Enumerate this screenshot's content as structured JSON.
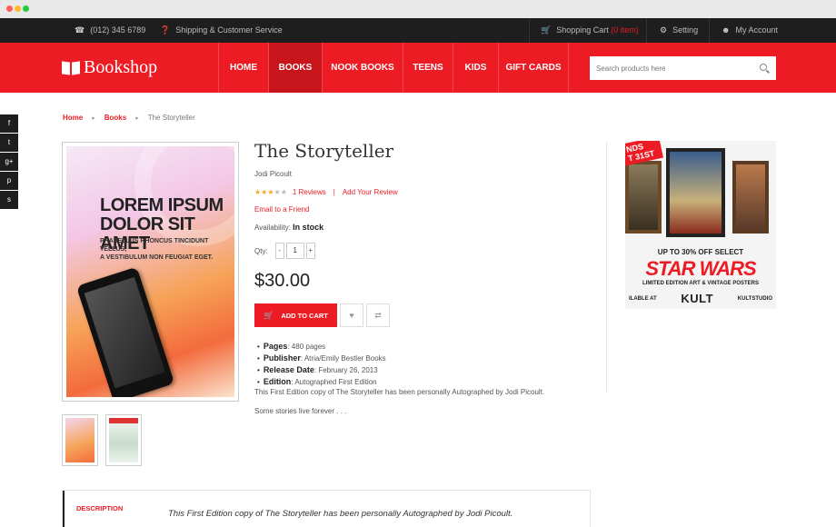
{
  "topbar": {
    "phone": "(012) 345 6789",
    "service": "Shipping & Customer Service",
    "cart_label": "Shopping Cart",
    "cart_count": "(0 item)",
    "setting": "Setting",
    "account": "My Account"
  },
  "brand": {
    "name": "Bookshop"
  },
  "nav": {
    "items": [
      {
        "label": "HOME"
      },
      {
        "label": "BOOKS"
      },
      {
        "label": "NOOK BOOKS"
      },
      {
        "label": "TEENS"
      },
      {
        "label": "KIDS"
      },
      {
        "label": "GIFT CARDS"
      }
    ],
    "active": "BOOKS"
  },
  "search": {
    "placeholder": "Search products here"
  },
  "social": [
    "f",
    "t",
    "g+",
    "p",
    "s"
  ],
  "breadcrumb": {
    "home": "Home",
    "section": "Books",
    "current": "The Storyteller"
  },
  "product": {
    "title": "The Storyteller",
    "author": "Jodi Picoult",
    "rating": 3,
    "rating_max": 5,
    "reviews": "1 Reviews",
    "add_review": "Add Your Review",
    "email_friend": "Email to a Friend",
    "availability_label": "Availability:",
    "availability_value": "In stock",
    "qty_label": "Qty:",
    "qty_minus": "-",
    "qty_value": "1",
    "qty_plus": "+",
    "price": "$30.00",
    "add_to_cart": "ADD TO CART",
    "specs": [
      {
        "key": "Pages",
        "value": "480 pages"
      },
      {
        "key": "Publisher",
        "value": "Atria/Emily Bestler Books"
      },
      {
        "key": "Release Date",
        "value": "February 26, 2013"
      },
      {
        "key": "Edition",
        "value": "Autographed First Edition"
      }
    ],
    "note": "This First Edition copy of The Storyteller has been personally Autographed by Jodi Picoult.",
    "tagline": "Some stories live forever . . ."
  },
  "cover": {
    "line1": "LOREM IPSUM",
    "line2": "DOLOR SIT AMET",
    "line3": "PHASELLUS RHONCUS TINCIDUNT TELLUS,",
    "line4": "A VESTIBULUM NON FEUGIAT EGET."
  },
  "ad": {
    "ribbon_line1": "NDS",
    "ribbon_line2": "T 31ST",
    "headline": "UP TO 30% OFF SELECT",
    "title": "STAR WARS",
    "subtitle": "LIMITED EDITION ART & VINTAGE POSTERS",
    "available": "ILABLE AT",
    "brand": "KULT",
    "site": "KULTSTUDIO"
  },
  "tabs": {
    "description_label": "DESCRIPTION",
    "description_text": "This First Edition copy of The Storyteller has been personally Autographed by Jodi Picoult."
  },
  "colors": {
    "accent": "#ed1c24",
    "dark": "#1e1e1e",
    "active_nav": "#c8141b"
  }
}
